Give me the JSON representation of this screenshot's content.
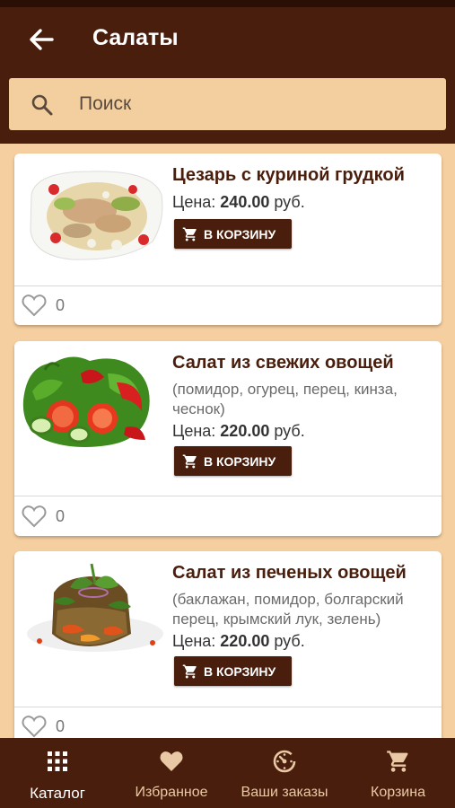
{
  "header": {
    "title": "Салаты"
  },
  "search": {
    "placeholder": "Поиск",
    "value": ""
  },
  "products": [
    {
      "name": "Цезарь с куриной грудкой",
      "description": "",
      "price_label": "Цена:",
      "price_value": "240.00",
      "price_unit": "руб.",
      "cart_button": "В КОРЗИНУ",
      "likes": "0"
    },
    {
      "name": "Салат из свежих овощей",
      "description": "(помидор, огурец, перец, кинза, чеснок)",
      "price_label": "Цена:",
      "price_value": "220.00",
      "price_unit": "руб.",
      "cart_button": "В КОРЗИНУ",
      "likes": "0"
    },
    {
      "name": "Салат из печеных овощей",
      "description": "(баклажан, помидор, болгарский перец, крымский лук, зелень)",
      "price_label": "Цена:",
      "price_value": "220.00",
      "price_unit": "руб.",
      "cart_button": "В КОРЗИНУ",
      "likes": "0"
    }
  ],
  "tabs": [
    {
      "label": "Каталог",
      "icon": "grid-icon",
      "active": true
    },
    {
      "label": "Избранное",
      "icon": "heart-icon",
      "active": false
    },
    {
      "label": "Ваши заказы",
      "icon": "clock-icon",
      "active": false
    },
    {
      "label": "Корзина",
      "icon": "cart-icon",
      "active": false
    }
  ],
  "colors": {
    "primary": "#4a1e0c",
    "background": "#f5cf9f",
    "search_bg": "#f3cf9f",
    "tab_label": "#e9c9a5"
  }
}
